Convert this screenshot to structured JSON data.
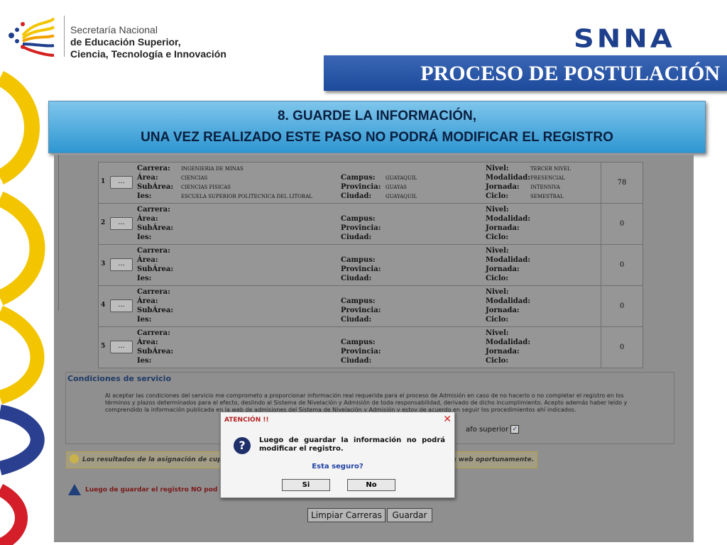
{
  "header": {
    "logo_line1": "Secretaría Nacional",
    "logo_line2": "de Educación Superior,",
    "logo_line3": "Ciencia, Tecnología e Innovación",
    "brand": "SNNA",
    "process_title": "PROCESO DE POSTULACIÓN"
  },
  "step": {
    "line1": "8. GUARDE LA INFORMACIÓN,",
    "line2": "UNA VEZ REALIZADO ESTE PASO NO PODRÁ MODIFICAR EL REGISTRO"
  },
  "labels": {
    "carrera": "Carrera:",
    "area": "Área:",
    "subarea": "SubÁrea:",
    "ies": "Ies:",
    "campus": "Campus:",
    "provincia": "Provincia:",
    "ciudad": "Ciudad:",
    "nivel": "Nivel:",
    "modalidad": "Modalidad:",
    "jornada": "Jornada:",
    "ciclo": "Ciclo:",
    "select_button": "..."
  },
  "rows": [
    {
      "num": "1",
      "carrera": "INGENIERIA DE MINAS",
      "area": "CIENCIAS",
      "subarea": "CIENCIAS FISICAS",
      "ies": "ESCUELA SUPERIOR POLITECNICA DEL LITORAL",
      "campus": "GUAYAQUIL",
      "provincia": "GUAYAS",
      "ciudad": "GUAYAQUIL",
      "nivel": "TERCER NIVEL",
      "modalidad": "PRESENCIAL",
      "jornada": "INTENSIVA",
      "ciclo": "SEMESTRAL",
      "score": "78"
    },
    {
      "num": "2",
      "score": "0"
    },
    {
      "num": "3",
      "score": "0"
    },
    {
      "num": "4",
      "score": "0"
    },
    {
      "num": "5",
      "score": "0"
    }
  ],
  "conditions": {
    "title": "Condiciones de servicio",
    "text": "Al aceptar las condiciones del servicio me comprometo a proporcionar información real requerida para el proceso de Admisión en caso de no hacerlo o no completar el registro en los términos y plazos determinados para el efecto, deslindo al Sistema de Nivelación y Admisión de toda responsabilidad, derivado de dicho incumplimiento. Acepto además haber leído y comprendido la información publicada en la web de admisiones del Sistema de Nivelación y Admisión y estoy de acuerdo en seguir los procedimientos ahí indicados.",
    "accept_fragment": "afo superior",
    "accept_checked": "✓"
  },
  "info": {
    "left": "Los resultados de la asignación de cupos",
    "right": "ina web oportunamente."
  },
  "warning": {
    "text": "Luego de guardar el registro NO pod"
  },
  "buttons": {
    "clear": "Limpiar Carreras",
    "save": "Guardar"
  },
  "dialog": {
    "title": "ATENCIÓN !!",
    "close": "✕",
    "icon": "?",
    "message": "Luego de guardar la información no podrá modificar el registro.",
    "question": "Esta seguro?",
    "yes": "Si",
    "no": "No"
  },
  "colors": {
    "brand_blue": "#1d3f8c",
    "step_box": "#2e96d1",
    "dialog_title": "#b22222"
  }
}
